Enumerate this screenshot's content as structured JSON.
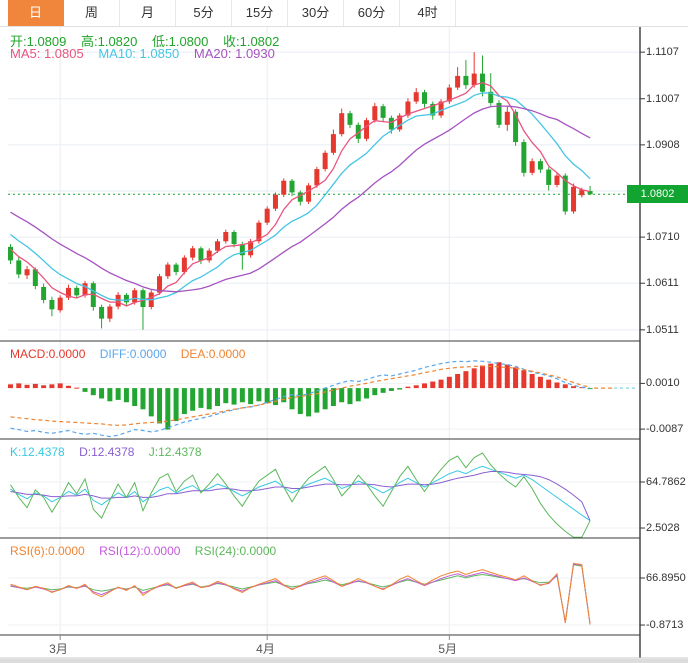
{
  "toolbar": {
    "tabs": [
      {
        "label": "日",
        "active": true
      },
      {
        "label": "周",
        "active": false
      },
      {
        "label": "月",
        "active": false
      },
      {
        "label": "5分",
        "active": false
      },
      {
        "label": "15分",
        "active": false
      },
      {
        "label": "30分",
        "active": false
      },
      {
        "label": "60分",
        "active": false
      },
      {
        "label": "4时",
        "active": false
      }
    ]
  },
  "colors": {
    "accent_tab": "#f0863b",
    "up_candle": "#e5382e",
    "down_candle": "#23a532",
    "ohlc_text": "#21a42c",
    "price_badge": "#12a430",
    "ma5": "#ea547e",
    "ma10": "#45c5e5",
    "ma20": "#a653c0",
    "macd_bar_up": "#e5382e",
    "macd_bar_down": "#23a532",
    "diff_line": "#5aa6ec",
    "dea_line": "#f08431",
    "k_line": "#37c9e3",
    "d_line": "#8a5fd0",
    "j_line": "#5cb85c",
    "rsi6": "#f08431",
    "rsi12": "#c45bdb",
    "rsi24": "#5cb85c",
    "grid_v": "#ededed",
    "grid_h": "#e7edf3",
    "grid_h_light": "#eef2f6",
    "divider": "#3a3a3a",
    "axis_text": "#333333",
    "dashed_tail": "#7fd8e8"
  },
  "legends": {
    "ohlc": [
      {
        "text": "开:1.0809",
        "color": "#21a42c"
      },
      {
        "text": "高:1.0820",
        "color": "#21a42c"
      },
      {
        "text": "低:1.0800",
        "color": "#21a42c"
      },
      {
        "text": "收:1.0802",
        "color": "#21a42c"
      }
    ],
    "ma": [
      {
        "text": "MA5: 1.0805",
        "color": "#ea547e"
      },
      {
        "text": "MA10: 1.0850",
        "color": "#45c5e5"
      },
      {
        "text": "MA20: 1.0930",
        "color": "#a653c0"
      }
    ],
    "macd": [
      {
        "text": "MACD:0.0000",
        "color": "#e5382e"
      },
      {
        "text": "DIFF:0.0000",
        "color": "#5aa6ec"
      },
      {
        "text": "DEA:0.0000",
        "color": "#f08431"
      }
    ],
    "kdj": [
      {
        "text": "K:12.4378",
        "color": "#37c9e3"
      },
      {
        "text": "D:12.4378",
        "color": "#8a5fd0"
      },
      {
        "text": "J:12.4378",
        "color": "#5cb85c"
      }
    ],
    "rsi": [
      {
        "text": "RSI(6):0.0000",
        "color": "#f08431"
      },
      {
        "text": "RSI(12):0.0000",
        "color": "#c45bdb"
      },
      {
        "text": "RSI(24):0.0000",
        "color": "#5cb85c"
      }
    ]
  },
  "chart_data": [
    {
      "type": "candlestick",
      "timeframe": "daily",
      "ylim": [
        1.0487,
        1.1161
      ],
      "y_gridlines": [
        1.1107,
        1.1007,
        1.0908,
        1.0809,
        1.071,
        1.0611,
        1.0511
      ],
      "y_ticks": [
        {
          "label": "1.1107",
          "value": 1.1107
        },
        {
          "label": "1.1007",
          "value": 1.1007
        },
        {
          "label": "1.0908",
          "value": 1.0908
        },
        {
          "label": "1.0710",
          "value": 1.071
        },
        {
          "label": "1.0611",
          "value": 1.0611
        },
        {
          "label": "1.0511",
          "value": 1.0511
        }
      ],
      "price_line": {
        "label": "1.0802",
        "value": 1.0802
      },
      "x_axis": {
        "months": [
          {
            "label": "3月",
            "index": 6
          },
          {
            "label": "4月",
            "index": 31
          },
          {
            "label": "5月",
            "index": 53
          }
        ]
      },
      "ma_windows": [
        5,
        10,
        20
      ],
      "pre_closes": [
        1.0845,
        1.0838,
        1.083,
        1.0822,
        1.0815,
        1.0807,
        1.08,
        1.0792,
        1.0785,
        1.0777,
        1.077,
        1.0762,
        1.0748,
        1.0735,
        1.0722,
        1.071,
        1.0698,
        1.0682,
        1.067
      ],
      "candles": [
        [
          1.0689,
          1.0695,
          1.0652,
          1.066
        ],
        [
          1.066,
          1.0668,
          1.0622,
          1.063
        ],
        [
          1.0628,
          1.0648,
          1.062,
          1.0641
        ],
        [
          1.0641,
          1.0645,
          1.0598,
          1.0605
        ],
        [
          1.0603,
          1.061,
          1.0568,
          1.0575
        ],
        [
          1.0575,
          1.0582,
          1.054,
          1.0555
        ],
        [
          1.0553,
          1.0585,
          1.0548,
          1.058
        ],
        [
          1.058,
          1.0608,
          1.0575,
          1.0601
        ],
        [
          1.0601,
          1.0606,
          1.0578,
          1.0585
        ],
        [
          1.0585,
          1.0616,
          1.058,
          1.0611
        ],
        [
          1.0611,
          1.0615,
          1.0552,
          1.056
        ],
        [
          1.056,
          1.0565,
          1.0514,
          1.0535
        ],
        [
          1.0535,
          1.0566,
          1.0528,
          1.0561
        ],
        [
          1.0561,
          1.0592,
          1.0555,
          1.0586
        ],
        [
          1.0586,
          1.059,
          1.0562,
          1.057
        ],
        [
          1.057,
          1.0601,
          1.0565,
          1.0596
        ],
        [
          1.0596,
          1.06,
          1.0511,
          1.056
        ],
        [
          1.056,
          1.0596,
          1.0555,
          1.0591
        ],
        [
          1.0591,
          1.0631,
          1.0586,
          1.0626
        ],
        [
          1.0626,
          1.0656,
          1.062,
          1.0651
        ],
        [
          1.0651,
          1.0655,
          1.0628,
          1.0635
        ],
        [
          1.0635,
          1.0671,
          1.063,
          1.0666
        ],
        [
          1.0666,
          1.0691,
          1.066,
          1.0686
        ],
        [
          1.0686,
          1.069,
          1.0652,
          1.066
        ],
        [
          1.066,
          1.0686,
          1.0655,
          1.0681
        ],
        [
          1.0681,
          1.0706,
          1.0676,
          1.0701
        ],
        [
          1.0701,
          1.0726,
          1.0696,
          1.0721
        ],
        [
          1.0721,
          1.0725,
          1.0688,
          1.0695
        ],
        [
          1.0695,
          1.07,
          1.064,
          1.0671
        ],
        [
          1.0671,
          1.0706,
          1.0666,
          1.0701
        ],
        [
          1.0701,
          1.0746,
          1.0696,
          1.0741
        ],
        [
          1.0741,
          1.0776,
          1.0736,
          1.0771
        ],
        [
          1.0771,
          1.0806,
          1.0766,
          1.0801
        ],
        [
          1.0801,
          1.0836,
          1.0796,
          1.0831
        ],
        [
          1.0831,
          1.0835,
          1.0798,
          1.0806
        ],
        [
          1.0806,
          1.081,
          1.0778,
          1.0786
        ],
        [
          1.0786,
          1.0826,
          1.0781,
          1.0821
        ],
        [
          1.0821,
          1.0861,
          1.0816,
          1.0856
        ],
        [
          1.0856,
          1.0896,
          1.0851,
          1.0891
        ],
        [
          1.0891,
          1.0941,
          1.0886,
          1.0931
        ],
        [
          1.0931,
          1.0986,
          1.0926,
          1.0976
        ],
        [
          1.0976,
          1.0981,
          1.0944,
          1.0951
        ],
        [
          1.0951,
          1.0956,
          1.0912,
          1.0921
        ],
        [
          1.0921,
          1.0966,
          1.0916,
          1.0961
        ],
        [
          1.0961,
          1.0998,
          1.0956,
          1.0991
        ],
        [
          1.0991,
          1.0996,
          1.0958,
          1.0966
        ],
        [
          1.0966,
          1.0971,
          1.0932,
          1.0941
        ],
        [
          1.0941,
          1.0976,
          1.0936,
          1.0971
        ],
        [
          1.0971,
          1.1008,
          1.0966,
          1.1001
        ],
        [
          1.1001,
          1.103,
          1.0996,
          1.1021
        ],
        [
          1.1021,
          1.1026,
          1.0988,
          1.0996
        ],
        [
          1.0996,
          1.1001,
          1.0962,
          1.0971
        ],
        [
          1.0971,
          1.1006,
          1.0966,
          1.1001
        ],
        [
          1.1001,
          1.1038,
          1.0996,
          1.1031
        ],
        [
          1.1031,
          1.1075,
          1.1026,
          1.1056
        ],
        [
          1.1056,
          1.109,
          1.1028,
          1.1036
        ],
        [
          1.1036,
          1.1107,
          1.1031,
          1.1061
        ],
        [
          1.1061,
          1.11,
          1.1012,
          1.1022
        ],
        [
          1.1022,
          1.1062,
          1.0992,
          1.0998
        ],
        [
          1.0998,
          1.1004,
          1.0944,
          1.0951
        ],
        [
          1.0951,
          1.0991,
          1.0938,
          1.0979
        ],
        [
          1.0979,
          1.0984,
          1.0906,
          1.0914
        ],
        [
          1.0914,
          1.092,
          1.084,
          1.0848
        ],
        [
          1.0848,
          1.0879,
          1.0843,
          1.0873
        ],
        [
          1.0873,
          1.0878,
          1.0848,
          1.0855
        ],
        [
          1.0855,
          1.086,
          1.081,
          1.0822
        ],
        [
          1.0822,
          1.0848,
          1.0817,
          1.0842
        ],
        [
          1.0842,
          1.0847,
          1.0758,
          1.0765
        ],
        [
          1.0765,
          1.0825,
          1.076,
          1.0818
        ],
        [
          1.08,
          1.0816,
          1.0795,
          1.0812
        ],
        [
          1.0809,
          1.082,
          1.08,
          1.0802
        ]
      ]
    },
    {
      "type": "macd",
      "ylim": [
        -0.0108,
        0.01
      ],
      "y_ticks": [
        {
          "label": "0.0010",
          "value": 0.001
        },
        {
          "label": "-0.0087",
          "value": -0.0087
        }
      ],
      "hist": [
        0.0008,
        0.001,
        0.0007,
        0.0009,
        0.0006,
        0.0008,
        0.001,
        0.0005,
        0.0001,
        -0.0008,
        -0.0015,
        -0.0022,
        -0.0028,
        -0.0025,
        -0.003,
        -0.0038,
        -0.0045,
        -0.006,
        -0.0075,
        -0.0088,
        -0.007,
        -0.0055,
        -0.0048,
        -0.0042,
        -0.0045,
        -0.0038,
        -0.0032,
        -0.0035,
        -0.003,
        -0.0034,
        -0.0028,
        -0.0032,
        -0.0036,
        -0.003,
        -0.0045,
        -0.0055,
        -0.006,
        -0.0052,
        -0.0045,
        -0.0038,
        -0.003,
        -0.0034,
        -0.0028,
        -0.0022,
        -0.0015,
        -0.001,
        -0.0006,
        -0.0003,
        0.0003,
        0.0006,
        0.001,
        0.0014,
        0.0018,
        0.0024,
        0.003,
        0.0036,
        0.0042,
        0.0048,
        0.0052,
        0.0055,
        0.005,
        0.0044,
        0.0038,
        0.003,
        0.0024,
        0.0018,
        0.0012,
        0.0008,
        0.0004,
        0.0002,
        -0.0001
      ],
      "diff": [
        -0.0085,
        -0.0088,
        -0.0092,
        -0.009,
        -0.0094,
        -0.0096,
        -0.0093,
        -0.009,
        -0.0095,
        -0.0098,
        -0.0096,
        -0.01,
        -0.0103,
        -0.01,
        -0.0094,
        -0.0088,
        -0.009,
        -0.0093,
        -0.009,
        -0.0084,
        -0.0078,
        -0.0072,
        -0.0068,
        -0.0064,
        -0.006,
        -0.0055,
        -0.005,
        -0.0046,
        -0.0042,
        -0.004,
        -0.0036,
        -0.003,
        -0.0024,
        -0.0018,
        -0.0014,
        -0.0016,
        -0.0012,
        -0.0006,
        0.0,
        0.0006,
        0.0012,
        0.0016,
        0.0014,
        0.0018,
        0.0024,
        0.0028,
        0.0026,
        0.003,
        0.0034,
        0.0038,
        0.0044,
        0.0048,
        0.0052,
        0.0055,
        0.0057,
        0.0056,
        0.0058,
        0.0057,
        0.0055,
        0.0052,
        0.005,
        0.0046,
        0.004,
        0.0034,
        0.003,
        0.0026,
        0.002,
        0.0012,
        0.0006,
        0.0002,
        0.0
      ],
      "dea": [
        -0.0061,
        -0.0063,
        -0.0065,
        -0.0067,
        -0.0068,
        -0.007,
        -0.0071,
        -0.0072,
        -0.0073,
        -0.0074,
        -0.0075,
        -0.0076,
        -0.0078,
        -0.0079,
        -0.0078,
        -0.0076,
        -0.0074,
        -0.0073,
        -0.0072,
        -0.007,
        -0.0067,
        -0.0064,
        -0.0061,
        -0.0058,
        -0.0055,
        -0.0052,
        -0.0048,
        -0.0045,
        -0.0042,
        -0.0039,
        -0.0036,
        -0.0032,
        -0.0028,
        -0.0024,
        -0.002,
        -0.0018,
        -0.0015,
        -0.0012,
        -0.0008,
        -0.0004,
        0.0,
        0.0004,
        0.0007,
        0.001,
        0.0014,
        0.0017,
        0.002,
        0.0023,
        0.0026,
        0.0029,
        0.0033,
        0.0036,
        0.004,
        0.0042,
        0.0044,
        0.0045,
        0.0046,
        0.0047,
        0.0046,
        0.0045,
        0.0044,
        0.0042,
        0.0039,
        0.0036,
        0.0032,
        0.0028,
        0.0024,
        0.0018,
        0.0012,
        0.0006,
        0.0002
      ]
    },
    {
      "type": "kdj",
      "ylim": [
        -11,
        123
      ],
      "y_ticks": [
        {
          "label": "64.7862",
          "value": 64.7862
        },
        {
          "label": "2.5028",
          "value": 2.5028
        }
      ],
      "k": [
        55,
        48,
        42,
        50,
        46,
        38,
        44,
        52,
        47,
        55,
        40,
        34,
        42,
        50,
        44,
        52,
        38,
        46,
        54,
        58,
        50,
        56,
        60,
        52,
        56,
        62,
        58,
        52,
        46,
        52,
        58,
        62,
        66,
        58,
        50,
        56,
        62,
        66,
        70,
        64,
        56,
        60,
        66,
        62,
        56,
        50,
        56,
        64,
        70,
        64,
        58,
        64,
        70,
        76,
        80,
        76,
        82,
        86,
        82,
        78,
        74,
        70,
        74,
        68,
        60,
        52,
        44,
        36,
        28,
        20,
        12.44
      ],
      "d": [
        52,
        50,
        48,
        48,
        47,
        45,
        45,
        46,
        46,
        48,
        46,
        43,
        43,
        44,
        44,
        46,
        44,
        44,
        46,
        49,
        49,
        51,
        53,
        53,
        53,
        55,
        56,
        55,
        53,
        53,
        54,
        56,
        58,
        58,
        56,
        56,
        58,
        60,
        62,
        62,
        61,
        61,
        62,
        62,
        61,
        59,
        58,
        60,
        62,
        62,
        61,
        62,
        64,
        67,
        70,
        72,
        74,
        77,
        79,
        79,
        78,
        76,
        75,
        74,
        72,
        68,
        62,
        55,
        47,
        38,
        12.44
      ],
      "j_rule": "J = 3K - 2D"
    },
    {
      "type": "rsi",
      "ylim": [
        -15.2,
        124.5
      ],
      "y_ticks": [
        {
          "label": "66.8950",
          "value": 66.895
        },
        {
          "label": "-0.8713",
          "value": -0.8713
        }
      ],
      "rsi6": [
        58,
        54,
        50,
        55,
        52,
        46,
        50,
        56,
        52,
        58,
        45,
        40,
        47,
        54,
        49,
        56,
        42,
        50,
        56,
        60,
        52,
        57,
        61,
        53,
        56,
        62,
        58,
        51,
        46,
        53,
        58,
        62,
        66,
        57,
        50,
        56,
        62,
        66,
        70,
        63,
        55,
        60,
        66,
        61,
        55,
        50,
        57,
        65,
        70,
        63,
        57,
        64,
        70,
        74,
        77,
        72,
        76,
        79,
        75,
        71,
        68,
        64,
        70,
        63,
        56,
        60,
        73,
        2,
        88,
        86,
        0
      ],
      "rsi12": [
        56,
        53,
        50,
        54,
        51,
        47,
        50,
        55,
        52,
        56,
        47,
        43,
        48,
        53,
        50,
        55,
        45,
        50,
        55,
        58,
        52,
        56,
        59,
        53,
        55,
        60,
        57,
        52,
        48,
        53,
        57,
        60,
        63,
        56,
        51,
        55,
        60,
        63,
        67,
        61,
        55,
        59,
        63,
        60,
        55,
        51,
        56,
        62,
        66,
        61,
        56,
        61,
        66,
        70,
        73,
        69,
        72,
        75,
        72,
        69,
        66,
        63,
        67,
        62,
        57,
        59,
        71,
        3,
        87,
        85,
        0
      ],
      "rsi24": [
        55,
        53,
        52,
        54,
        52,
        50,
        51,
        54,
        53,
        55,
        50,
        48,
        50,
        53,
        51,
        54,
        49,
        52,
        55,
        57,
        53,
        56,
        58,
        54,
        56,
        59,
        57,
        54,
        51,
        54,
        57,
        59,
        61,
        57,
        54,
        56,
        59,
        61,
        64,
        61,
        57,
        60,
        62,
        60,
        57,
        54,
        57,
        61,
        64,
        61,
        58,
        61,
        64,
        67,
        70,
        67,
        70,
        72,
        70,
        68,
        66,
        64,
        66,
        63,
        60,
        61,
        70,
        4,
        86,
        84,
        0
      ]
    }
  ]
}
